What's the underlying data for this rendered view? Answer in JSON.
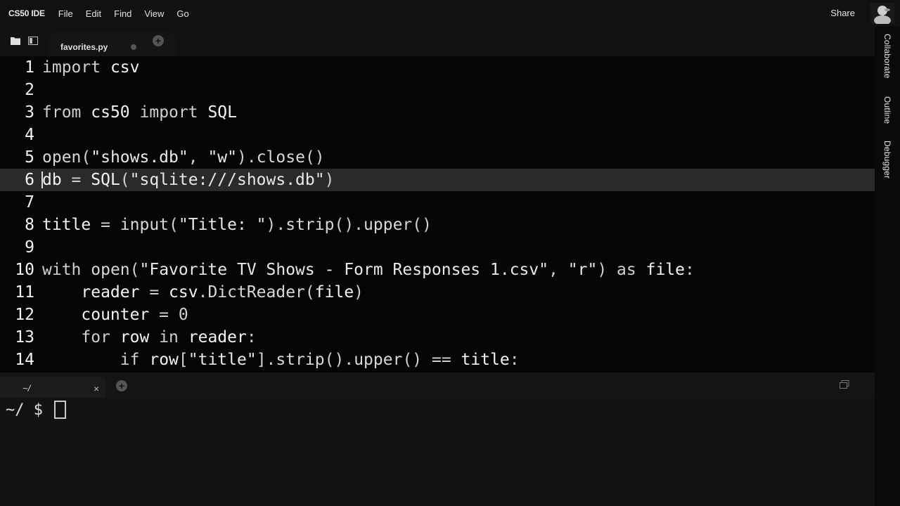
{
  "app": {
    "brand": "CS50 IDE",
    "share_label": "Share"
  },
  "menu": [
    "File",
    "Edit",
    "Find",
    "View",
    "Go"
  ],
  "tab": {
    "filename": "favorites.py",
    "plus": "+"
  },
  "editor": {
    "active_line": 6,
    "lines": [
      {
        "n": "1",
        "tokens": [
          [
            "import",
            "kw"
          ],
          [
            " ",
            "op"
          ],
          [
            "csv",
            "name"
          ]
        ]
      },
      {
        "n": "2",
        "tokens": []
      },
      {
        "n": "3",
        "tokens": [
          [
            "from",
            "kw"
          ],
          [
            " ",
            "op"
          ],
          [
            "cs50",
            "name"
          ],
          [
            " ",
            "op"
          ],
          [
            "import",
            "kw"
          ],
          [
            " ",
            "op"
          ],
          [
            "SQL",
            "name"
          ]
        ]
      },
      {
        "n": "4",
        "tokens": []
      },
      {
        "n": "5",
        "tokens": [
          [
            "open",
            "fn"
          ],
          [
            "(",
            "op"
          ],
          [
            "\"shows.db\"",
            "str"
          ],
          [
            ", ",
            "op"
          ],
          [
            "\"w\"",
            "str"
          ],
          [
            ").",
            "op"
          ],
          [
            "close",
            "fn"
          ],
          [
            "()",
            "op"
          ]
        ]
      },
      {
        "n": "6",
        "tokens": [
          [
            "db",
            "name"
          ],
          [
            " = ",
            "op"
          ],
          [
            "SQL",
            "name"
          ],
          [
            "(",
            "op"
          ],
          [
            "\"sqlite:///shows.db\"",
            "str"
          ],
          [
            ")",
            "op"
          ]
        ]
      },
      {
        "n": "7",
        "tokens": []
      },
      {
        "n": "8",
        "tokens": [
          [
            "title",
            "name"
          ],
          [
            " = ",
            "op"
          ],
          [
            "input",
            "fn"
          ],
          [
            "(",
            "op"
          ],
          [
            "\"Title: \"",
            "str"
          ],
          [
            ").",
            "op"
          ],
          [
            "strip",
            "fn"
          ],
          [
            "().",
            "op"
          ],
          [
            "upper",
            "fn"
          ],
          [
            "()",
            "op"
          ]
        ]
      },
      {
        "n": "9",
        "tokens": []
      },
      {
        "n": "10",
        "tokens": [
          [
            "with",
            "kw"
          ],
          [
            " ",
            "op"
          ],
          [
            "open",
            "fn"
          ],
          [
            "(",
            "op"
          ],
          [
            "\"Favorite TV Shows - Form Responses 1.csv\"",
            "str"
          ],
          [
            ", ",
            "op"
          ],
          [
            "\"r\"",
            "str"
          ],
          [
            ") ",
            "op"
          ],
          [
            "as",
            "kw"
          ],
          [
            " ",
            "op"
          ],
          [
            "file",
            "name"
          ],
          [
            ":",
            "op"
          ]
        ]
      },
      {
        "n": "11",
        "tokens": [
          [
            "    ",
            "op"
          ],
          [
            "reader",
            "name"
          ],
          [
            " = ",
            "op"
          ],
          [
            "csv",
            "name"
          ],
          [
            ".",
            "op"
          ],
          [
            "DictReader",
            "fn"
          ],
          [
            "(",
            "op"
          ],
          [
            "file",
            "name"
          ],
          [
            ")",
            "op"
          ]
        ]
      },
      {
        "n": "12",
        "tokens": [
          [
            "    ",
            "op"
          ],
          [
            "counter",
            "name"
          ],
          [
            " = ",
            "op"
          ],
          [
            "0",
            "kw"
          ]
        ]
      },
      {
        "n": "13",
        "tokens": [
          [
            "    ",
            "op"
          ],
          [
            "for",
            "kw"
          ],
          [
            " ",
            "op"
          ],
          [
            "row",
            "name"
          ],
          [
            " ",
            "op"
          ],
          [
            "in",
            "kw"
          ],
          [
            " ",
            "op"
          ],
          [
            "reader",
            "name"
          ],
          [
            ":",
            "op"
          ]
        ]
      },
      {
        "n": "14",
        "tokens": [
          [
            "        ",
            "op"
          ],
          [
            "if",
            "kw"
          ],
          [
            " ",
            "op"
          ],
          [
            "row",
            "name"
          ],
          [
            "[",
            "op"
          ],
          [
            "\"title\"",
            "str"
          ],
          [
            "].",
            "op"
          ],
          [
            "strip",
            "fn"
          ],
          [
            "().",
            "op"
          ],
          [
            "upper",
            "fn"
          ],
          [
            "() == ",
            "op"
          ],
          [
            "title",
            "name"
          ],
          [
            ":",
            "op"
          ]
        ]
      }
    ]
  },
  "terminal": {
    "tab_label": "~/",
    "close": "×",
    "plus": "+",
    "prompt": "~/ $"
  },
  "rail": [
    "Collaborate",
    "Outline",
    "Debugger"
  ]
}
